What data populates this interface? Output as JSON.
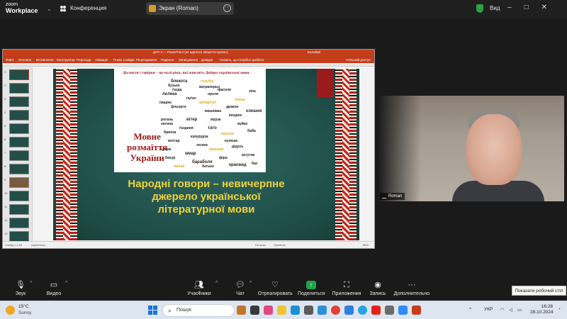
{
  "topbar": {
    "app_name_line1": "zoom",
    "app_name_line2": "Workplace",
    "conference_label": "Конференция",
    "screen_share_label": "Экран (Roman)",
    "view_label": "Вид"
  },
  "ppt": {
    "title": "ДУП 3 — PowerPoint (не вдалося зберегти проект)",
    "user": "Балабай",
    "menu": [
      "Файл",
      "Основне",
      "Вставлення",
      "Конструктор",
      "Переходи",
      "Анімація",
      "Показ слайдів",
      "Рецензування",
      "Подання",
      "Записування",
      "Довідка"
    ],
    "ribbon_note": "Скажіть, що потрібно зробити",
    "share_label": "Спільний доступ",
    "thumb_numbers": [
      "1",
      "2",
      "3",
      "4",
      "5",
      "6",
      "7",
      "8",
      "9",
      "10",
      "11",
      "12",
      "13"
    ],
    "status_left": "Слайд 1 з 48",
    "status_lang": "українська",
    "status_notes": "Нотатки",
    "status_comments": "Примітки",
    "zoom_value": "86%"
  },
  "slide": {
    "header": "Діалекти і говірки – це малі ріки, які живлять Дніпро української мови.",
    "mova_line1": "Мовне",
    "mova_line2": "розмаїття",
    "mova_line3": "України",
    "title_line1": "Народні говори – невичерпне",
    "title_line2": "джерело української",
    "title_line3": "літературної мови",
    "cloud_words": [
      "блекота",
      "бузько",
      "ґазда",
      "голубці",
      "ватраперьо",
      "лелека",
      "ореля",
      "пуґач",
      "пащінє",
      "фльорга",
      "шпаргат",
      "дракон",
      "вишнівка",
      "кендюх",
      "рогаль",
      "вітер",
      "мурза",
      "хижка",
      "хатина",
      "ґаздиня",
      "тато",
      "вуйко",
      "бринза",
      "кукурудза",
      "терезок",
      "клешня",
      "кептар",
      "лелюк",
      "кулеша",
      "цуцик",
      "жмар",
      "ванькир",
      "дідусь",
      "баба",
      "бахур",
      "бараболя",
      "фіра",
      "когутик",
      "малай",
      "батько",
      "краєвид",
      "зіпа",
      "фасоля",
      "бас"
    ]
  },
  "video": {
    "participant_name": "Roman"
  },
  "toolbar": {
    "audio": "Звук",
    "video": "Видео",
    "participants": "Участники",
    "participants_count": "2",
    "chat": "Чат",
    "react": "Отреагировать",
    "share": "Поделиться",
    "apps": "Приложения",
    "record": "Запись",
    "more": "Дополнительно",
    "tooltip": "Показати робочий стіл"
  },
  "taskbar": {
    "temp": "15°C",
    "weather": "Sunny",
    "search_placeholder": "Пошук",
    "lang": "УКР",
    "time": "16:28",
    "date": "28.10.2024"
  },
  "colors": {
    "ppt_accent": "#c43e1c",
    "slide_bg": "#234e47",
    "slide_title": "#f0d23c",
    "share_green": "#21a24a"
  }
}
